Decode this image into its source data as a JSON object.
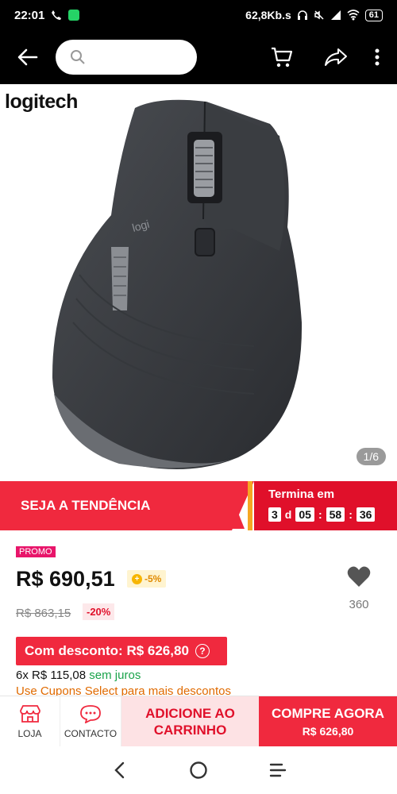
{
  "status_bar": {
    "time": "22:01",
    "speed": "62,8Kb.s",
    "battery": "61"
  },
  "search": {
    "placeholder": ""
  },
  "product": {
    "brand": "logitech",
    "image_counter": "1/6",
    "image_icon": "computer-mouse"
  },
  "promo_banner": {
    "label": "SEJA A TENDÊNCIA",
    "ends_in_label": "Termina em",
    "days": "3",
    "days_unit": "d",
    "hours": "05",
    "minutes": "58",
    "seconds": "36"
  },
  "price_info": {
    "tag": "PROMO",
    "price": "R$ 690,51",
    "coin_discount": "-5%",
    "old_price": "R$ 863,15",
    "discount_percent": "-20%",
    "favorites_count": "360",
    "discount_button": "Com desconto: R$ 626,80",
    "installments_count": "6x R$ 115,08",
    "installments_note": "sem juros",
    "coupon_line": "Use Cupons Select para mais descontos"
  },
  "actions": {
    "store": "LOJA",
    "contact": "CONTACTO",
    "add_to_cart": "ADICIONE AO CARRINHO",
    "buy_now": "COMPRE AGORA",
    "buy_now_price": "R$ 626,80"
  },
  "colors": {
    "primary_red": "#f0293e",
    "promo_pink": "#e8156a",
    "green": "#1aa34a"
  }
}
